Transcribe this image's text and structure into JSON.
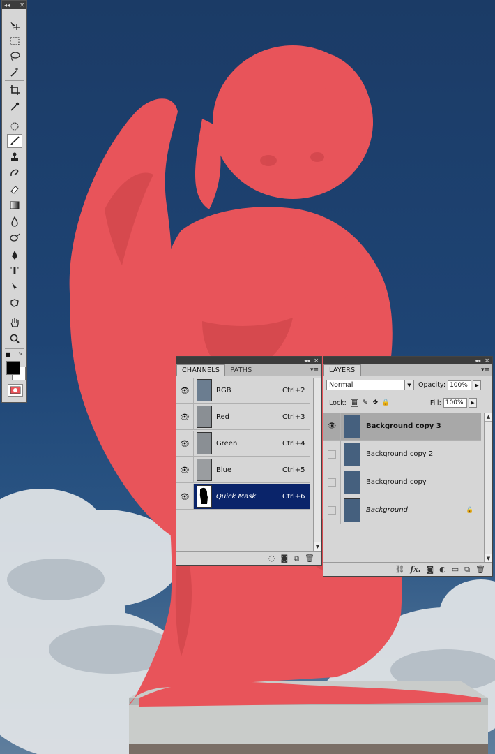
{
  "toolbox": {
    "collapse_icon": "double-left-arrow",
    "close_icon": "x",
    "tools": [
      {
        "name": "move-tool",
        "icon": "move-arrow"
      },
      {
        "name": "marquee-tool",
        "icon": "dashed-rectangle"
      },
      {
        "name": "lasso-tool",
        "icon": "lasso"
      },
      {
        "name": "magic-wand-tool",
        "icon": "wand"
      },
      {
        "name": "crop-tool",
        "icon": "crop"
      },
      {
        "name": "eyedropper-tool",
        "icon": "eyedropper"
      },
      {
        "name": "spot-healing-tool",
        "icon": "bandage"
      },
      {
        "name": "brush-tool",
        "icon": "brush",
        "active": true
      },
      {
        "name": "clone-stamp-tool",
        "icon": "stamp"
      },
      {
        "name": "history-brush-tool",
        "icon": "history-brush"
      },
      {
        "name": "eraser-tool",
        "icon": "eraser"
      },
      {
        "name": "gradient-tool",
        "icon": "gradient"
      },
      {
        "name": "blur-tool",
        "icon": "drop"
      },
      {
        "name": "dodge-tool",
        "icon": "dodge"
      },
      {
        "name": "pen-tool",
        "icon": "pen"
      },
      {
        "name": "type-tool",
        "icon": "T",
        "glyph": "T"
      },
      {
        "name": "path-selection-tool",
        "icon": "arrow"
      },
      {
        "name": "shape-tool",
        "icon": "custom-shape"
      },
      {
        "name": "hand-tool",
        "icon": "hand"
      },
      {
        "name": "zoom-tool",
        "icon": "magnifier"
      }
    ],
    "foreground_color": "#000000",
    "background_color": "#ffffff",
    "quick_mask_icon": "quick-mask"
  },
  "channels_panel": {
    "tabs": [
      {
        "label": "CHANNELS",
        "active": true
      },
      {
        "label": "PATHS",
        "active": false
      }
    ],
    "rows": [
      {
        "name": "RGB",
        "shortcut": "Ctrl+2",
        "visible": true
      },
      {
        "name": "Red",
        "shortcut": "Ctrl+3",
        "visible": true
      },
      {
        "name": "Green",
        "shortcut": "Ctrl+4",
        "visible": true
      },
      {
        "name": "Blue",
        "shortcut": "Ctrl+5",
        "visible": true
      },
      {
        "name": "Quick Mask",
        "shortcut": "Ctrl+6",
        "visible": true,
        "selected": true
      }
    ],
    "footer_icons": [
      "load-selection-icon",
      "save-selection-icon",
      "new-channel-icon",
      "delete-channel-icon"
    ]
  },
  "layers_panel": {
    "tab_label": "LAYERS",
    "blend_mode": "Normal",
    "opacity_label": "Opacity:",
    "opacity_value": "100%",
    "lock_label": "Lock:",
    "fill_label": "Fill:",
    "fill_value": "100%",
    "layers": [
      {
        "name": "Background copy 3",
        "visible": true,
        "selected": true
      },
      {
        "name": "Background copy 2",
        "visible": false
      },
      {
        "name": "Background copy",
        "visible": false
      },
      {
        "name": "Background",
        "visible": false,
        "locked": true
      }
    ],
    "footer_icons": [
      "link-icon",
      "fx-icon",
      "mask-icon",
      "adjustment-icon",
      "group-icon",
      "new-layer-icon",
      "delete-layer-icon"
    ],
    "fx_label": "fx."
  },
  "colors": {
    "quick_mask_overlay": "#e8545a",
    "selected_channel": "#0a246a",
    "panel_bg": "#d6d6d6"
  }
}
